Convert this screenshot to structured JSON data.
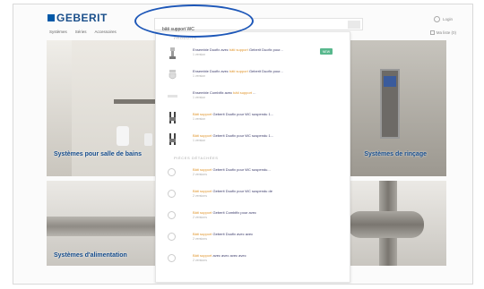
{
  "header": {
    "logo_text": "GEBERIT",
    "nav": [
      "Systèmes",
      "Séries",
      "Accessoires"
    ],
    "login_label": "Login",
    "mylist_label": "Ma liste (0)"
  },
  "search": {
    "value": "bâti support WC",
    "button_icon": "search-icon"
  },
  "hero": {
    "caption_left": "Systèmes pour salle de bains",
    "caption_right": "Systèmes de rinçage",
    "caption_bottom": "Systèmes d'alimentation"
  },
  "dropdown": {
    "products_title": "PRODUITS",
    "products": [
      {
        "pre": "Ensemble Duofix avec ",
        "hl": "bâti support",
        "post": " Geberit Duofix pour...",
        "sub": "1 version",
        "icon": "bati-support-icon",
        "badge": "NEW"
      },
      {
        "pre": "Ensemble Duofix avec ",
        "hl": "bâti support",
        "post": " Geberit Duofix pour...",
        "sub": "1 version",
        "icon": "wc-bowl-icon",
        "badge": ""
      },
      {
        "pre": "Ensemble Combifix avec ",
        "hl": "bâti support",
        "post": " ...",
        "sub": "1 version",
        "icon": "frame-icon",
        "badge": ""
      },
      {
        "pre": "",
        "hl": "Bâti support",
        "post": " Geberit Duofix pour WC suspendu 1...",
        "sub": "1 version",
        "icon": "frame-icon",
        "badge": ""
      },
      {
        "pre": "",
        "hl": "Bâti support",
        "post": " Geberit Duofix pour WC suspendu 1...",
        "sub": "1 version",
        "icon": "frame-icon",
        "badge": ""
      }
    ],
    "documents_title": "PIÈCES DÉTACHÉES",
    "documents": [
      {
        "pre": "",
        "hl": "Bâti support",
        "post": " Geberit Duofix pour WC suspendu...",
        "sub": "2 versions"
      },
      {
        "pre": "",
        "hl": "Bâti support",
        "post": " Geberit Duofix pour WC suspendu de",
        "sub": "2 versions"
      },
      {
        "pre": "",
        "hl": "Bâti support",
        "post": " Geberit Combifix pour avec",
        "sub": "2 versions"
      },
      {
        "pre": "",
        "hl": "Bâti support",
        "post": " Geberit Duofix avec avec",
        "sub": "2 versions"
      },
      {
        "pre": "",
        "hl": "Bâti support",
        "post": " avec avec avec avec",
        "sub": "2 versions"
      }
    ]
  }
}
